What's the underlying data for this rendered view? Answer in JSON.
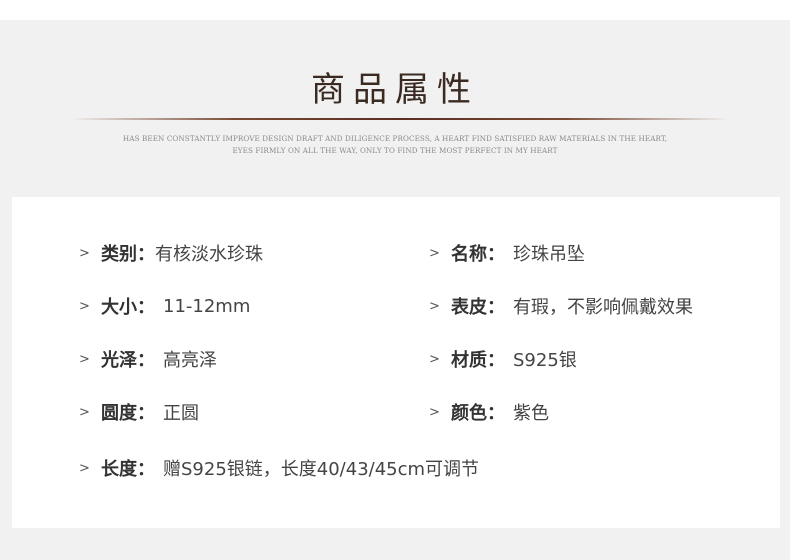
{
  "header": {
    "title": "商品属性",
    "subtitle_line1": "HAS BEEN CONSTANTLY IMPROVE DESIGN DRAFT AND DILIGENCE PROCESS, A HEART FIND SATISFIED RAW MATERIALS IN THE HEART,",
    "subtitle_line2": "EYES FIRMLY ON ALL THE WAY, ONLY TO FIND THE MOST PERFECT IN MY HEART"
  },
  "attributes": [
    {
      "marker": ">",
      "label": "类别：",
      "value": "有核淡水珍珠"
    },
    {
      "marker": ">",
      "label": "名称：",
      "value": "珍珠吊坠"
    },
    {
      "marker": ">",
      "label": "大小：",
      "value": "11-12mm"
    },
    {
      "marker": ">",
      "label": "表皮：",
      "value": "有瑕，不影响佩戴效果"
    },
    {
      "marker": ">",
      "label": "光泽：",
      "value": "高亮泽"
    },
    {
      "marker": ">",
      "label": "材质：",
      "value": "S925银"
    },
    {
      "marker": ">",
      "label": "圆度：",
      "value": "正圆"
    },
    {
      "marker": ">",
      "label": "颜色：",
      "value": "紫色"
    },
    {
      "marker": ">",
      "label": "长度：",
      "value": "赠S925银链，长度40/43/45cm可调节"
    }
  ]
}
